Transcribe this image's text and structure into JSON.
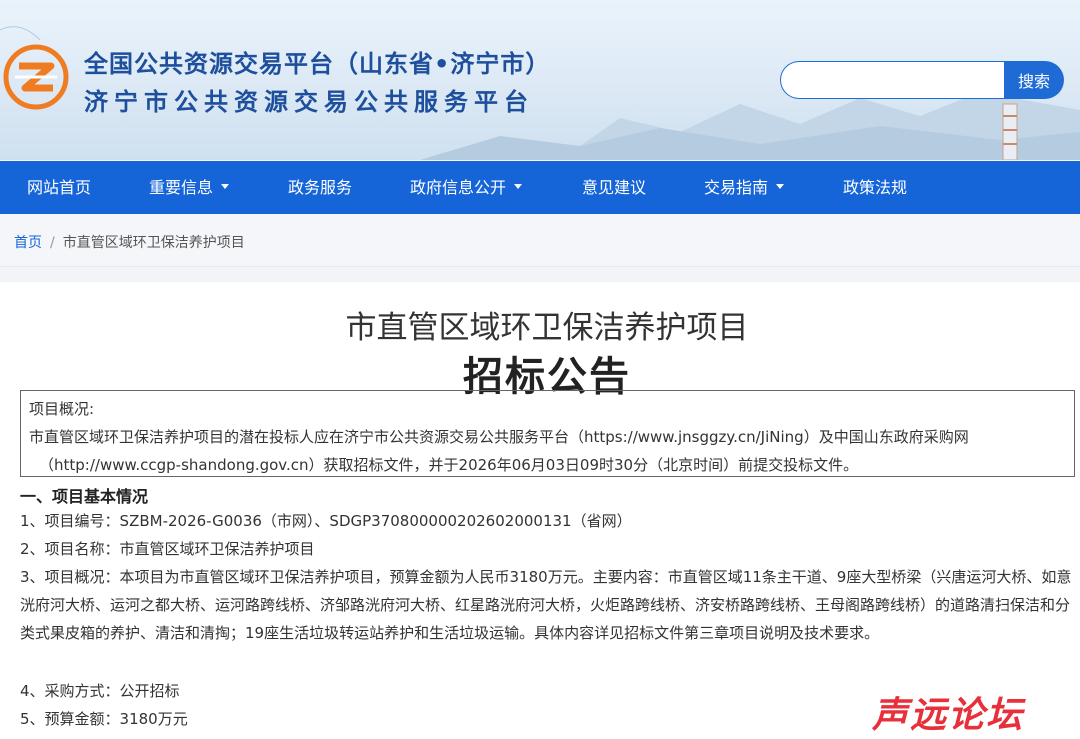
{
  "header": {
    "title_line1": "全国公共资源交易平台（山东省•济宁市）",
    "title_line2": "济宁市公共资源交易公共服务平台",
    "search_placeholder": "",
    "search_button": "搜索"
  },
  "nav": {
    "items": [
      {
        "label": "网站首页",
        "dropdown": false
      },
      {
        "label": "重要信息",
        "dropdown": true
      },
      {
        "label": "政务服务",
        "dropdown": false
      },
      {
        "label": "政府信息公开",
        "dropdown": true
      },
      {
        "label": "意见建议",
        "dropdown": false
      },
      {
        "label": "交易指南",
        "dropdown": true
      },
      {
        "label": "政策法规",
        "dropdown": false
      }
    ]
  },
  "breadcrumb": {
    "home": "首页",
    "separator": "/",
    "current": "市直管区域环卫保洁养护项目"
  },
  "article": {
    "title": "市直管区域环卫保洁养护项目",
    "subtitle": "招标公告",
    "overview_box": {
      "heading": "项目概况:",
      "line1": "市直管区域环卫保洁养护项目的潜在投标人应在济宁市公共资源交易公共服务平台（https://www.jnsggzy.cn/JiNing）及中国山东政府采购网",
      "line2": "（http://www.ccgp-shandong.gov.cn）获取招标文件，并于2026年06月03日09时30分（北京时间）前提交投标文件。"
    },
    "section1_heading": "一、项目基本情况",
    "item1": "1、项目编号：SZBM-2026-G0036（市网）、SDGP370800000202602000131（省网）",
    "item2": "2、项目名称：市直管区域环卫保洁养护项目",
    "item3": "3、项目概况：本项目为市直管区域环卫保洁养护项目，预算金额为人民币3180万元。主要内容：市直管区域11条主干道、9座大型桥梁（兴唐运河大桥、如意洸府河大桥、运河之都大桥、运河路跨线桥、济邹路洸府河大桥、红星路洸府河大桥，火炬路跨线桥、济安桥路跨线桥、王母阁路跨线桥）的道路清扫保洁和分类式果皮箱的养护、清洁和清掏；19座生活垃圾转运站养护和生活垃圾运输。具体内容详见招标文件第三章项目说明及技术要求。",
    "item4": "4、采购方式：公开招标",
    "item5": "5、预算金额：3180万元"
  },
  "watermark": "声远论坛",
  "colors": {
    "brand_blue": "#1565d8",
    "title_blue": "#1e4f9c",
    "logo_orange": "#f07c22",
    "watermark_red": "#e8303a"
  },
  "icons": {
    "logo": "orange-circle-z-logo",
    "caret": "caret-down-icon"
  }
}
